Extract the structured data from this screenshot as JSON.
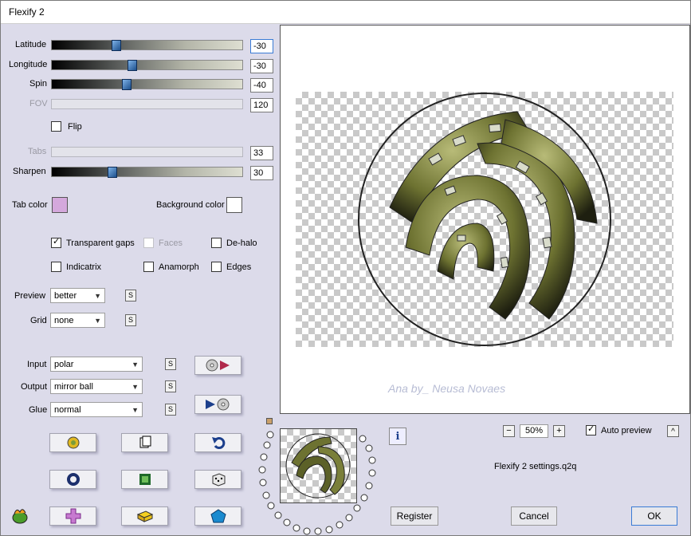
{
  "window": {
    "title": "Flexify 2"
  },
  "sliders": {
    "latitude": {
      "label": "Latitude",
      "value": "-30"
    },
    "longitude": {
      "label": "Longitude",
      "value": "-30"
    },
    "spin": {
      "label": "Spin",
      "value": "-40"
    },
    "fov": {
      "label": "FOV",
      "value": "120"
    },
    "tabs": {
      "label": "Tabs",
      "value": "33"
    },
    "sharpen": {
      "label": "Sharpen",
      "value": "30"
    }
  },
  "flip": {
    "label": "Flip",
    "checked": false
  },
  "colors": {
    "tab_label": "Tab color",
    "tab_color": "#d4a8dc",
    "bg_label": "Background color",
    "bg_color": "#ffffff"
  },
  "options": {
    "transparent_gaps": {
      "label": "Transparent gaps",
      "checked": true
    },
    "faces": {
      "label": "Faces",
      "checked": false
    },
    "de_halo": {
      "label": "De-halo",
      "checked": false
    },
    "indicatrix": {
      "label": "Indicatrix",
      "checked": false
    },
    "anamorph": {
      "label": "Anamorph",
      "checked": false
    },
    "edges": {
      "label": "Edges",
      "checked": false
    }
  },
  "selects": {
    "preview": {
      "label": "Preview",
      "value": "better"
    },
    "grid": {
      "label": "Grid",
      "value": "none"
    },
    "input": {
      "label": "Input",
      "value": "polar"
    },
    "output": {
      "label": "Output",
      "value": "mirror ball"
    },
    "glue": {
      "label": "Glue",
      "value": "normal"
    }
  },
  "s_label": "S",
  "preview_area": {
    "watermark": "Ana by_ Neusa Novaes"
  },
  "zoom": {
    "minus": "−",
    "value": "50%",
    "plus": "+"
  },
  "auto_preview": {
    "label": "Auto preview",
    "checked": true,
    "toggle": "^"
  },
  "settings_file": "Flexify 2 settings.q2q",
  "info_label": "i",
  "buttons": {
    "register": "Register",
    "cancel": "Cancel",
    "ok": "OK"
  },
  "accent": "#3a7bd5"
}
